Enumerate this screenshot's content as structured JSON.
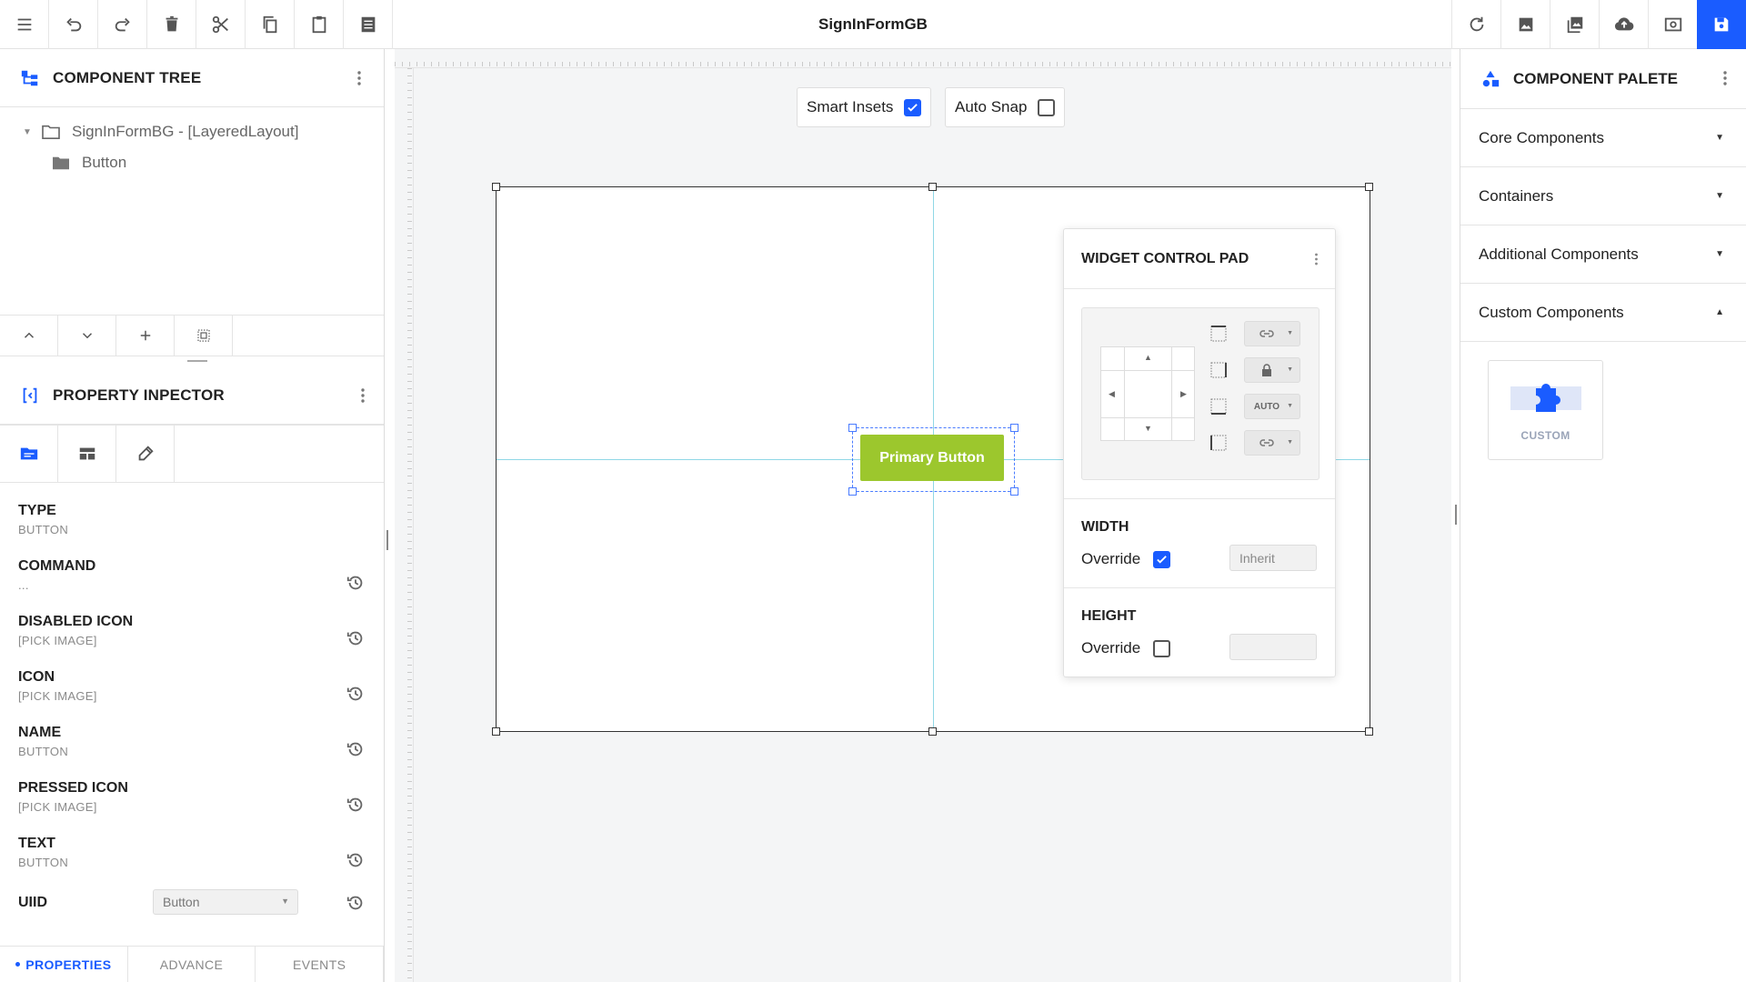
{
  "app": {
    "title": "SignInFormGB"
  },
  "toolbar": {
    "left_icons": [
      "menu-icon",
      "undo-icon",
      "redo-icon",
      "delete-icon",
      "cut-icon",
      "copy-icon",
      "paste-icon",
      "list-icon"
    ],
    "right_icons": [
      "refresh-icon",
      "image-icon",
      "gallery-icon",
      "upload-icon",
      "preview-icon",
      "save-icon"
    ],
    "accent_color": "#1a5cff"
  },
  "component_tree": {
    "title": "COMPONENT TREE",
    "root": "SignInFormBG - [LayeredLayout]",
    "child": "Button"
  },
  "property_inspector": {
    "title": "PROPERTY INPECTOR",
    "properties": [
      {
        "key": "TYPE",
        "value": "BUTTON"
      },
      {
        "key": "COMMAND",
        "value": "..."
      },
      {
        "key": "DISABLED ICON",
        "value": "[PICK IMAGE]"
      },
      {
        "key": "ICON",
        "value": "[PICK IMAGE]"
      },
      {
        "key": "NAME",
        "value": "BUTTON"
      },
      {
        "key": "PRESSED ICON",
        "value": "[PICK IMAGE]"
      },
      {
        "key": "TEXT",
        "value": "BUTTON"
      }
    ],
    "uiid": {
      "key": "UIID",
      "value": "Button"
    },
    "bottom_tabs": [
      "PROPERTIES",
      "ADVANCE",
      "EVENTS"
    ]
  },
  "canvas": {
    "smart_insets": {
      "label": "Smart Insets",
      "checked": true
    },
    "auto_snap": {
      "label": "Auto Snap",
      "checked": false
    },
    "primary_button": {
      "label": "Primary Button",
      "color": "#9cc72d"
    }
  },
  "widget_control_pad": {
    "title": "WIDGET CONTROL PAD",
    "auto_label": "AUTO",
    "width": {
      "title": "WIDTH",
      "override_label": "Override",
      "override_checked": true,
      "value_placeholder": "Inherit"
    },
    "height": {
      "title": "HEIGHT",
      "override_label": "Override",
      "override_checked": false,
      "value": ""
    }
  },
  "component_palette": {
    "title": "COMPONENT PALETE",
    "sections": [
      "Core Components",
      "Containers",
      "Additional Components",
      "Custom Components"
    ],
    "custom_tile": "CUSTOM"
  }
}
